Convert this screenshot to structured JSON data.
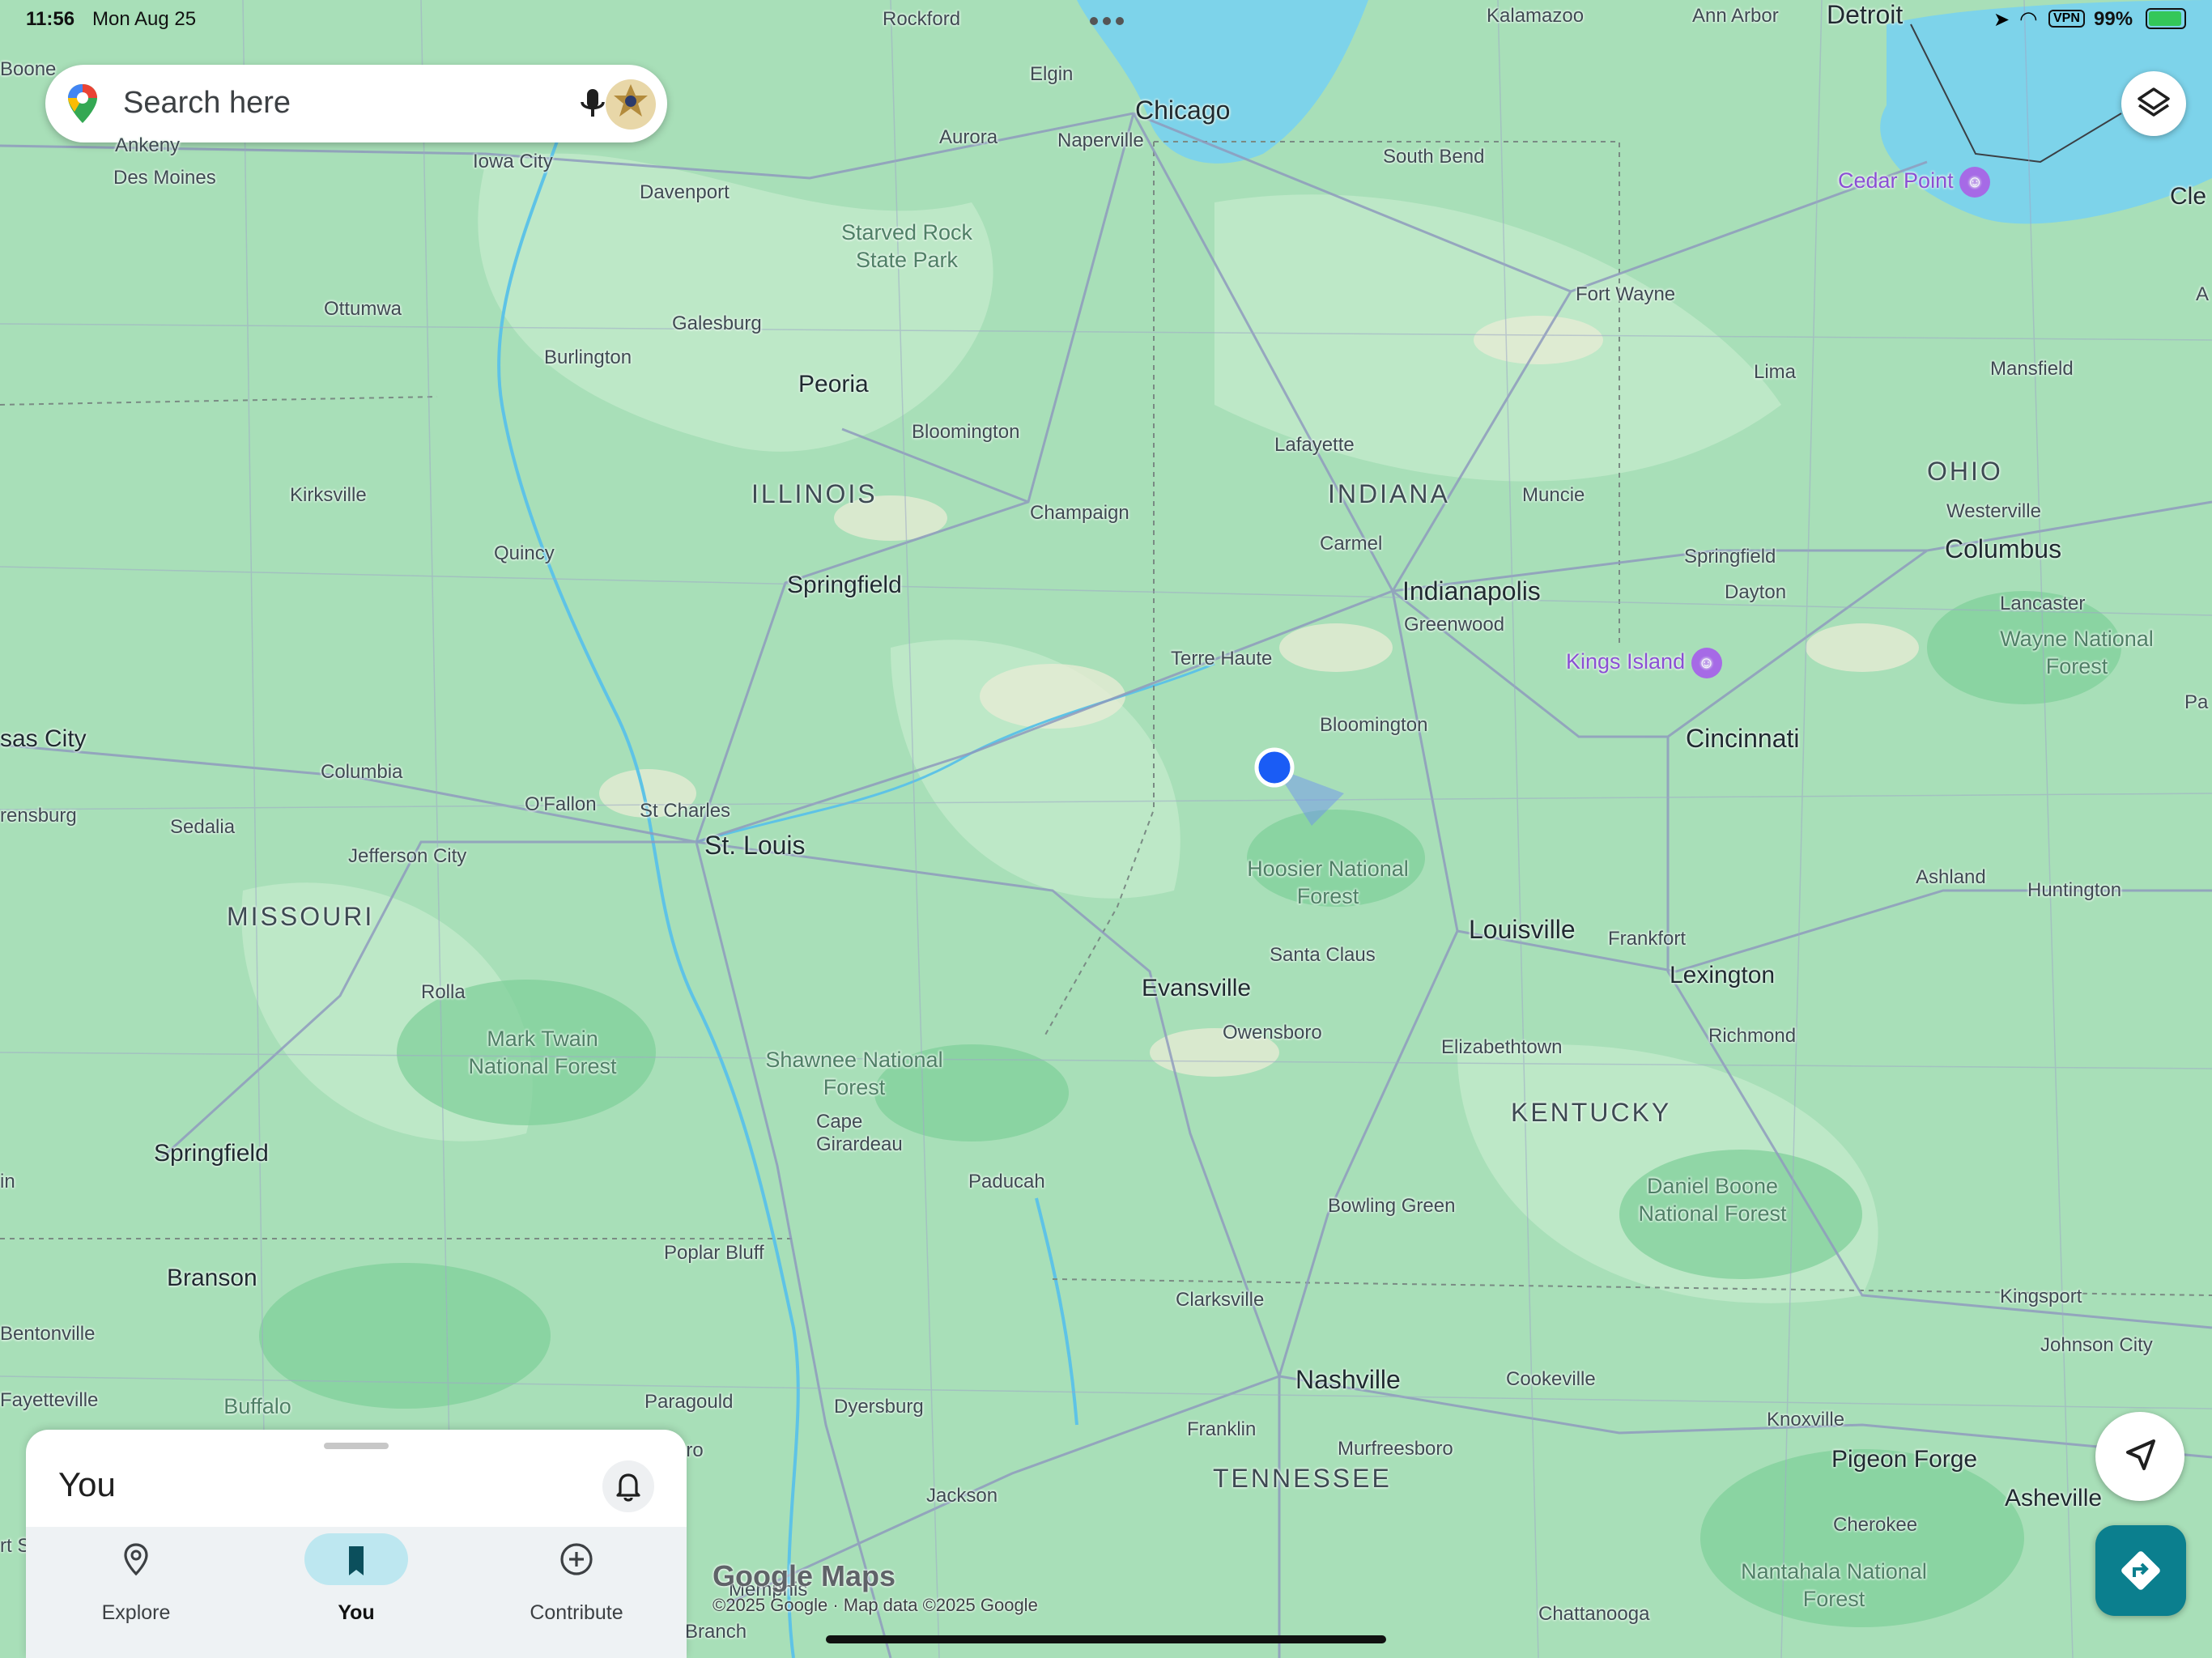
{
  "status_bar": {
    "time": "11:56",
    "date": "Mon Aug 25",
    "vpn": "VPN",
    "battery": "99%"
  },
  "search": {
    "placeholder": "Search here"
  },
  "map": {
    "states": [
      "ILLINOIS",
      "INDIANA",
      "OHIO",
      "MISSOURI",
      "KENTUCKY",
      "TENNESSEE"
    ],
    "major_cities": [
      "Chicago",
      "Indianapolis",
      "Columbus",
      "Cincinnati",
      "St. Louis",
      "Louisville",
      "Nashville",
      "Detroit"
    ],
    "cities": [
      "Rockford",
      "Kalamazoo",
      "Ann Arbor",
      "Boone",
      "Elgin",
      "Aurora",
      "Naperville",
      "Ankeny",
      "Des Moines",
      "Iowa City",
      "Davenport",
      "South Bend",
      "Fort Wayne",
      "Ottumwa",
      "Galesburg",
      "Burlington",
      "Peoria",
      "Bloomington",
      "Lafayette",
      "Lima",
      "Mansfield",
      "Kirksville",
      "Muncie",
      "Westerville",
      "Champaign",
      "Carmel",
      "Quincy",
      "Springfield",
      "Greenwood",
      "Dayton",
      "Lancaster",
      "Terre Haute",
      "Bloomington",
      "Columbia",
      "O'Fallon",
      "St Charles",
      "Sedalia",
      "Jefferson City",
      "Ashland",
      "Huntington",
      "Frankfort",
      "Santa Claus",
      "Evansville",
      "Lexington",
      "Owensboro",
      "Elizabethtown",
      "Richmond",
      "Rolla",
      "Springfield",
      "Paducah",
      "Bowling Green",
      "Poplar Bluff",
      "Branson",
      "Clarksville",
      "Kingsport",
      "Johnson City",
      "Bentonville",
      "Fayetteville",
      "Paragould",
      "Dyersburg",
      "Franklin",
      "Murfreesboro",
      "Cookeville",
      "Knoxville",
      "Pigeon Forge",
      "Asheville",
      "Cherokee",
      "Jackson",
      "Chattanooga",
      "Memphis",
      "Branch",
      "Springfield",
      "Cape Girardeau"
    ],
    "edge_labels": [
      "sas City",
      "rensburg",
      "Cle",
      "Pa",
      "A",
      "in",
      "rt S",
      "oro",
      "Buffalo"
    ],
    "parks": [
      "Starved Rock State Park",
      "Hoosier National Forest",
      "Mark Twain National Forest",
      "Shawnee National Forest",
      "Daniel Boone National Forest",
      "Wayne National Forest",
      "Nantahala National Forest"
    ],
    "pois": [
      "Cedar Point",
      "Kings Island"
    ]
  },
  "sheet": {
    "title": "You",
    "nav": [
      {
        "label": "Explore",
        "icon": "location-pin-icon"
      },
      {
        "label": "You",
        "icon": "bookmark-icon"
      },
      {
        "label": "Contribute",
        "icon": "plus-circle-icon"
      }
    ]
  },
  "attribution": {
    "logo": "Google Maps",
    "copyright": "©2025 Google · Map data ©2025 Google"
  },
  "colors": {
    "land": "#a8dfb8",
    "water": "#7dd3ea",
    "road": "#8f9bbd",
    "accent": "#0b7f8e",
    "location_dot": "#1a5cf5"
  }
}
